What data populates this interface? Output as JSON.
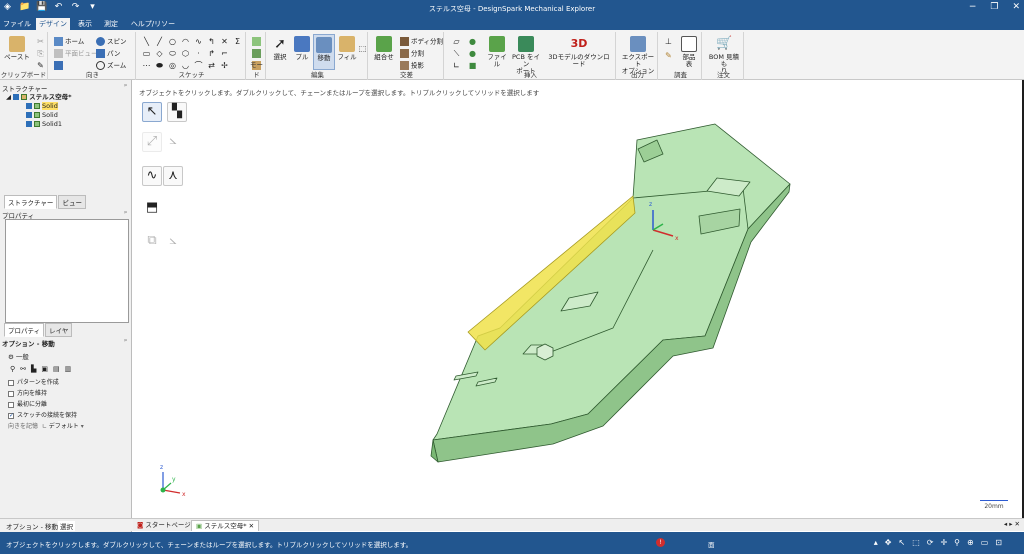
{
  "window": {
    "title": "ステルス空母 - DesignSpark Mechanical Explorer",
    "buttons": [
      "−",
      "❐",
      "✕"
    ]
  },
  "quick_access": [
    "◈",
    "📁",
    "💾",
    "↶",
    "↷",
    "▾"
  ],
  "menu_tabs": [
    {
      "label": "ファイル"
    },
    {
      "label": "デザイン"
    },
    {
      "label": "表示"
    },
    {
      "label": "測定"
    },
    {
      "label": "ヘルプ/リソース"
    }
  ],
  "ribbon": {
    "clipboard": {
      "paste": "ペースト",
      "group": "クリップボード"
    },
    "orient": {
      "home": "ホーム",
      "plane": "平面ビュー",
      "spin": "スピン",
      "pan": "パン",
      "zoom": "ズーム",
      "group": "向き"
    },
    "sketch": {
      "group": "スケッチ"
    },
    "mode": {
      "group": "モード"
    },
    "edit": {
      "select": "選択",
      "pull": "プル",
      "move": "移動",
      "fill": "フィル",
      "group": "編集"
    },
    "intersect": {
      "combine": "組合せ",
      "split_body": "ボディ分割",
      "split": "分割",
      "project": "投影",
      "group": "交差"
    },
    "insert": {
      "file": "ファイル",
      "pcb": "PCB をイン",
      "pcb2": "ポート",
      "download": "3Dモデルのダウンロード",
      "group": "挿入"
    },
    "output": {
      "export": "エクスポート",
      "options": "オプション",
      "group": "出力"
    },
    "investigate": {
      "parts": "部品",
      "parts2": "表",
      "group": "調査"
    },
    "order": {
      "bom": "BOM 見積も",
      "bom2": "り",
      "group": "注文"
    }
  },
  "structure": {
    "title": "ストラクチャー",
    "root": "ステルス空母*",
    "items": [
      "Solid",
      "Solid",
      "Solid1"
    ]
  },
  "panel_tabs": {
    "structure": "ストラクチャー",
    "view": "ビュー"
  },
  "properties": {
    "title": "プロパティ"
  },
  "prop_tabs": {
    "properties": "プロパティ",
    "layers": "レイヤ"
  },
  "options": {
    "title": "オプション - 移動",
    "general": "一般",
    "checks": [
      {
        "label": "パターンを作成",
        "checked": false
      },
      {
        "label": "方向を維持",
        "checked": false
      },
      {
        "label": "最初に分離",
        "checked": false
      },
      {
        "label": "スケッチの接続を保持",
        "checked": true
      }
    ],
    "orient_label": "向きを記憶",
    "orient_value": "デフォルト"
  },
  "bottom_left_tabs": {
    "options": "オプション - 移動",
    "select": "選択"
  },
  "canvas": {
    "hint": "オブジェクトをクリックします。ダブルクリックして、チェーンまたはループを選択します。トリプルクリックしてソリッドを選択します",
    "scale": "20mm",
    "axis": {
      "z": "z",
      "y": "y",
      "x": "x"
    }
  },
  "doc_tabs": {
    "start": "スタートページ",
    "doc": "ステルス空母*"
  },
  "status": {
    "message": "オブジェクトをクリックします。ダブルクリックして、チェーンまたはループを選択します。トリプルクリックしてソリッドを選択します。",
    "badge": "!",
    "mode": "面"
  },
  "colors": {
    "accent": "#22568f",
    "model_fill": "#a8dba8",
    "model_edge": "#2f5a2f",
    "selected_face": "#f0e24a"
  }
}
